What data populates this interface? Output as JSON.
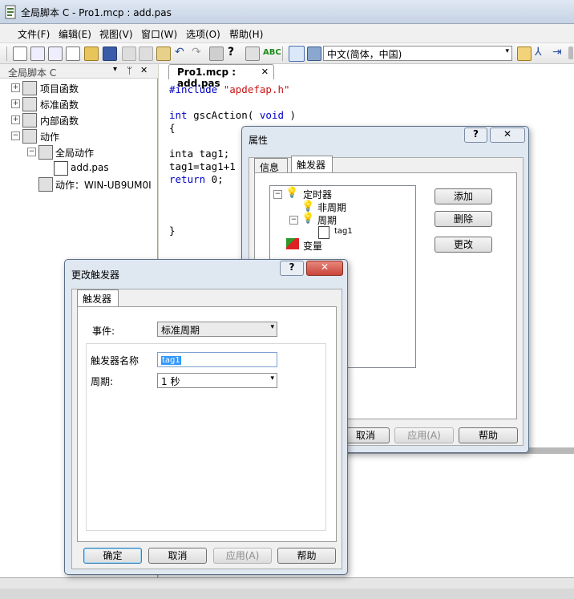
{
  "window": {
    "title": "全局脚本 C - Pro1.mcp : add.pas"
  },
  "menu": [
    "文件(F)",
    "编辑(E)",
    "视图(V)",
    "窗口(W)",
    "选项(O)",
    "帮助(H)"
  ],
  "toolbar": {
    "language": "中文(简体，中国)"
  },
  "sidebar": {
    "title": "全局脚本 C",
    "items": [
      "项目函数",
      "标准函数",
      "内部函数",
      "动作",
      "全局动作",
      "add.pas",
      "动作：WIN-UB9UM0I"
    ]
  },
  "editor": {
    "tab": "Pro1.mcp : add.pas",
    "lines": [
      "#include ",
      "\"apdefap.h\"",
      "int",
      " gscAction( ",
      "void",
      " )",
      "{",
      "inta tag1;",
      "tag1=tag1+1",
      "return",
      " 0;",
      "}"
    ]
  },
  "props_dialog": {
    "title": "属性",
    "tabs": [
      "信息",
      "触发器"
    ],
    "tree": [
      "定时器",
      "非周期",
      "周期",
      "tag1",
      "变量"
    ],
    "buttons": [
      "添加",
      "删除",
      "更改",
      "取消",
      "应用(A)",
      "帮助"
    ],
    "help_glyph": "?",
    "close_glyph": "✕"
  },
  "change_dialog": {
    "title": "更改触发器",
    "tab": "触发器",
    "event_label": "事件:",
    "event_value": "标准周期",
    "name_label": "触发器名称",
    "name_value": "tag1",
    "period_label": "周期:",
    "period_value": "1 秒",
    "buttons": [
      "确定",
      "取消",
      "应用(A)",
      "帮助"
    ],
    "help_glyph": "?",
    "close_glyph": "✕"
  },
  "glyphs": {
    "pin": "ᛘ",
    "close": "✕",
    "dropdown": "▾",
    "expand": "+",
    "collapse": "−"
  },
  "colors": {
    "keyword": "#0000c8",
    "string": "#c81414",
    "selection": "#3399ff",
    "close_red": "#c9453a"
  }
}
